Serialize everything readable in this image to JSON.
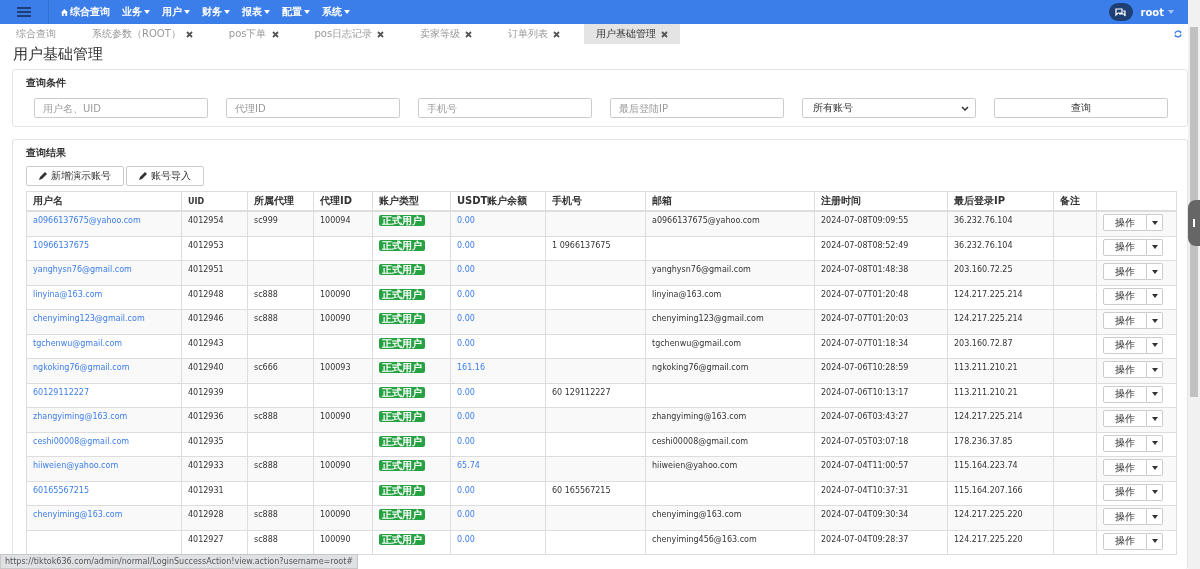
{
  "nav": {
    "items": [
      {
        "label": "综合查询",
        "kind": "home"
      },
      {
        "label": "业务",
        "kind": "menu"
      },
      {
        "label": "用户",
        "kind": "menu"
      },
      {
        "label": "财务",
        "kind": "menu"
      },
      {
        "label": "报表",
        "kind": "menu"
      },
      {
        "label": "配置",
        "kind": "menu"
      },
      {
        "label": "系统",
        "kind": "menu"
      }
    ],
    "user": "root"
  },
  "tabs": [
    {
      "label": "综合查询",
      "closable": false,
      "selected": false
    },
    {
      "label": "系统参数（ROOT）",
      "closable": true,
      "selected": false
    },
    {
      "label": "pos下单",
      "closable": true,
      "selected": false
    },
    {
      "label": "pos日志记录",
      "closable": true,
      "selected": false
    },
    {
      "label": "卖家等级",
      "closable": true,
      "selected": false
    },
    {
      "label": "订单列表",
      "closable": true,
      "selected": false
    },
    {
      "label": "用户基础管理",
      "closable": true,
      "selected": true
    }
  ],
  "page_title": "用户基础管理",
  "query": {
    "title": "查询条件",
    "fields": [
      {
        "placeholder": "用户名、UID"
      },
      {
        "placeholder": "代理ID"
      },
      {
        "placeholder": "手机号"
      },
      {
        "placeholder": "最后登陆IP"
      }
    ],
    "select": "所有账号",
    "button": "查询"
  },
  "results": {
    "title": "查询结果",
    "buttons": [
      "新增演示账号",
      "账号导入"
    ],
    "columns": [
      "用户名",
      "UID",
      "所属代理",
      "代理ID",
      "账户类型",
      "USDT账户余额",
      "手机号",
      "邮箱",
      "注册时间",
      "最后登录IP",
      "备注"
    ],
    "rows": [
      {
        "username": "a0966137675@yahoo.com",
        "uid": "4012954",
        "agent": "sc999",
        "agent_id": "100094",
        "type": "正式用户",
        "balance": "0.00",
        "phone": "",
        "email": "a0966137675@yahoo.com",
        "registered": "2024-07-08T09:09:55",
        "ip": "36.232.76.104",
        "action": "操作"
      },
      {
        "username": "10966137675",
        "uid": "4012953",
        "agent": "",
        "agent_id": "",
        "type": "正式用户",
        "balance": "0.00",
        "phone": "1 0966137675",
        "email": "",
        "registered": "2024-07-08T08:52:49",
        "ip": "36.232.76.104",
        "action": "操作"
      },
      {
        "username": "yanghysn76@gmail.com",
        "uid": "4012951",
        "agent": "",
        "agent_id": "",
        "type": "正式用户",
        "balance": "0.00",
        "phone": "",
        "email": "yanghysn76@gmail.com",
        "registered": "2024-07-08T01:48:38",
        "ip": "203.160.72.25",
        "action": "操作"
      },
      {
        "username": "linyina@163.com",
        "uid": "4012948",
        "agent": "sc888",
        "agent_id": "100090",
        "type": "正式用户",
        "balance": "0.00",
        "phone": "",
        "email": "linyina@163.com",
        "registered": "2024-07-07T01:20:48",
        "ip": "124.217.225.214",
        "action": "操作"
      },
      {
        "username": "chenyiming123@gmail.com",
        "uid": "4012946",
        "agent": "sc888",
        "agent_id": "100090",
        "type": "正式用户",
        "balance": "0.00",
        "phone": "",
        "email": "chenyiming123@gmail.com",
        "registered": "2024-07-07T01:20:03",
        "ip": "124.217.225.214",
        "action": "操作"
      },
      {
        "username": "tgchenwu@gmail.com",
        "uid": "4012943",
        "agent": "",
        "agent_id": "",
        "type": "正式用户",
        "balance": "0.00",
        "phone": "",
        "email": "tgchenwu@gmail.com",
        "registered": "2024-07-07T01:18:34",
        "ip": "203.160.72.87",
        "action": "操作"
      },
      {
        "username": "ngkoking76@gmail.com",
        "uid": "4012940",
        "agent": "sc666",
        "agent_id": "100093",
        "type": "正式用户",
        "balance": "161.16",
        "phone": "",
        "email": "ngkoking76@gmail.com",
        "registered": "2024-07-06T10:28:59",
        "ip": "113.211.210.21",
        "action": "操作"
      },
      {
        "username": "60129112227",
        "uid": "4012939",
        "agent": "",
        "agent_id": "",
        "type": "正式用户",
        "balance": "0.00",
        "phone": "60 129112227",
        "email": "",
        "registered": "2024-07-06T10:13:17",
        "ip": "113.211.210.21",
        "action": "操作"
      },
      {
        "username": "zhangyiming@163.com",
        "uid": "4012936",
        "agent": "sc888",
        "agent_id": "100090",
        "type": "正式用户",
        "balance": "0.00",
        "phone": "",
        "email": "zhangyiming@163.com",
        "registered": "2024-07-06T03:43:27",
        "ip": "124.217.225.214",
        "action": "操作"
      },
      {
        "username": "ceshi00008@gmail.com",
        "uid": "4012935",
        "agent": "",
        "agent_id": "",
        "type": "正式用户",
        "balance": "0.00",
        "phone": "",
        "email": "ceshi00008@gmail.com",
        "registered": "2024-07-05T03:07:18",
        "ip": "178.236.37.85",
        "action": "操作"
      },
      {
        "username": "hiiweien@yahoo.com",
        "uid": "4012933",
        "agent": "sc888",
        "agent_id": "100090",
        "type": "正式用户",
        "balance": "65.74",
        "phone": "",
        "email": "hiiweien@yahoo.com",
        "registered": "2024-07-04T11:00:57",
        "ip": "115.164.223.74",
        "action": "操作"
      },
      {
        "username": "60165567215",
        "uid": "4012931",
        "agent": "",
        "agent_id": "",
        "type": "正式用户",
        "balance": "0.00",
        "phone": "60 165567215",
        "email": "",
        "registered": "2024-07-04T10:37:31",
        "ip": "115.164.207.166",
        "action": "操作"
      },
      {
        "username": "chenyiming@163.com",
        "uid": "4012928",
        "agent": "sc888",
        "agent_id": "100090",
        "type": "正式用户",
        "balance": "0.00",
        "phone": "",
        "email": "chenyiming@163.com",
        "registered": "2024-07-04T09:30:34",
        "ip": "124.217.225.220",
        "action": "操作"
      },
      {
        "uid": "4012927",
        "agent": "sc888",
        "agent_id": "100090",
        "type": "正式用户",
        "balance": "0.00",
        "phone": "",
        "email": "chenyiming456@163.com",
        "registered": "2024-07-04T09:28:37",
        "ip": "124.217.225.220",
        "action": "操作"
      }
    ]
  },
  "status_bar": "https://tiktok636.com/admin/normal/LoginSuccessAction!view.action?username=root#"
}
